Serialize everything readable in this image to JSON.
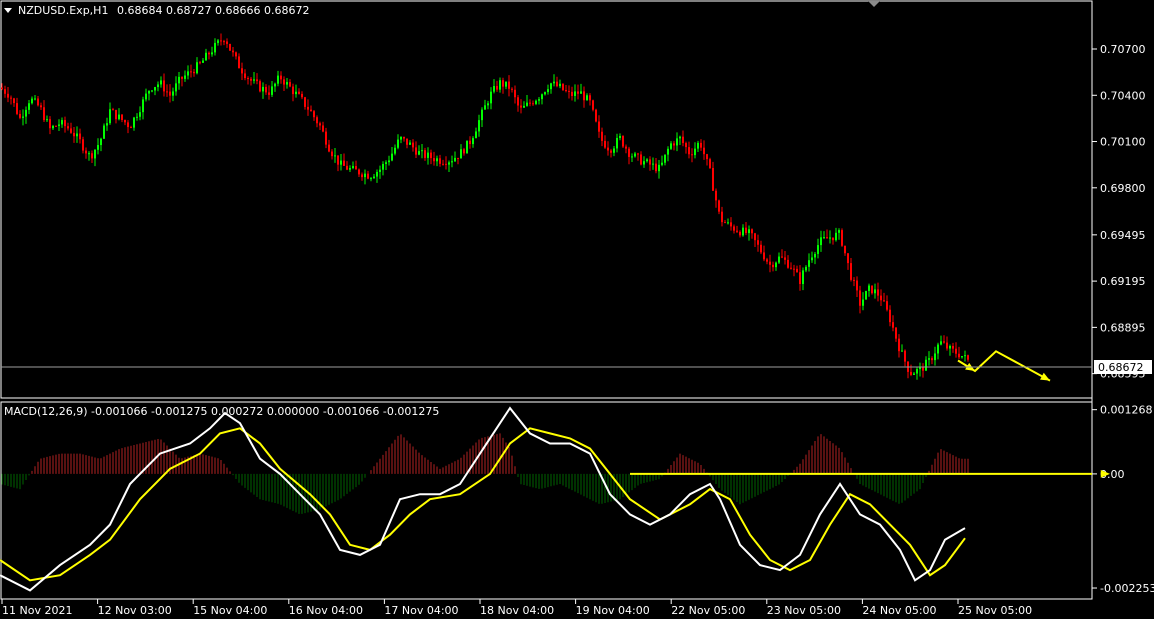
{
  "chart_data": [
    {
      "type": "candlestick",
      "symbol_label": "NZDUSD.Exp,H1",
      "ohlc_label": "0.68684 0.68727 0.68666 0.68672",
      "current_price": "0.68672",
      "y_ticks": [
        "0.70700",
        "0.70400",
        "0.70100",
        "0.69800",
        "0.69495",
        "0.69195",
        "0.68895",
        "0.68595"
      ],
      "ylim": [
        0.6845,
        0.7094
      ],
      "x_ticks": [
        "11 Nov 2021",
        "12 Nov 03:00",
        "15 Nov 04:00",
        "16 Nov 04:00",
        "17 Nov 04:00",
        "18 Nov 04:00",
        "19 Nov 04:00",
        "22 Nov 05:00",
        "23 Nov 05:00",
        "24 Nov 05:00",
        "25 Nov 05:00"
      ],
      "close_path": [
        [
          0,
          0.7045
        ],
        [
          10,
          0.704
        ],
        [
          20,
          0.7025
        ],
        [
          30,
          0.7038
        ],
        [
          40,
          0.7032
        ],
        [
          50,
          0.7018
        ],
        [
          60,
          0.7022
        ],
        [
          70,
          0.7018
        ],
        [
          80,
          0.701
        ],
        [
          90,
          0.7
        ],
        [
          100,
          0.701
        ],
        [
          110,
          0.703
        ],
        [
          120,
          0.7025
        ],
        [
          130,
          0.702
        ],
        [
          140,
          0.7032
        ],
        [
          150,
          0.7045
        ],
        [
          160,
          0.7048
        ],
        [
          170,
          0.704
        ],
        [
          180,
          0.705
        ],
        [
          190,
          0.7055
        ],
        [
          200,
          0.706
        ],
        [
          210,
          0.7068
        ],
        [
          220,
          0.7075
        ],
        [
          225,
          0.7078
        ],
        [
          230,
          0.707
        ],
        [
          240,
          0.7058
        ],
        [
          250,
          0.705
        ],
        [
          260,
          0.7045
        ],
        [
          270,
          0.7042
        ],
        [
          280,
          0.7052
        ],
        [
          290,
          0.7045
        ],
        [
          300,
          0.7038
        ],
        [
          310,
          0.703
        ],
        [
          320,
          0.702
        ],
        [
          330,
          0.7005
        ],
        [
          340,
          0.6995
        ],
        [
          350,
          0.6992
        ],
        [
          360,
          0.699
        ],
        [
          370,
          0.6988
        ],
        [
          380,
          0.6992
        ],
        [
          390,
          0.7
        ],
        [
          400,
          0.7012
        ],
        [
          410,
          0.7008
        ],
        [
          420,
          0.7002
        ],
        [
          430,
          0.7
        ],
        [
          440,
          0.6998
        ],
        [
          450,
          0.6998
        ],
        [
          460,
          0.7002
        ],
        [
          470,
          0.701
        ],
        [
          480,
          0.7025
        ],
        [
          490,
          0.704
        ],
        [
          500,
          0.7048
        ],
        [
          510,
          0.7045
        ],
        [
          520,
          0.703
        ],
        [
          530,
          0.7035
        ],
        [
          540,
          0.704
        ],
        [
          550,
          0.7048
        ],
        [
          560,
          0.7045
        ],
        [
          570,
          0.704
        ],
        [
          580,
          0.7042
        ],
        [
          590,
          0.7035
        ],
        [
          600,
          0.7012
        ],
        [
          610,
          0.7005
        ],
        [
          620,
          0.7012
        ],
        [
          630,
          0.7002
        ],
        [
          640,
          0.6998
        ],
        [
          650,
          0.6995
        ],
        [
          660,
          0.6992
        ],
        [
          670,
          0.7008
        ],
        [
          680,
          0.7012
        ],
        [
          690,
          0.7002
        ],
        [
          700,
          0.701
        ],
        [
          710,
          0.699
        ],
        [
          720,
          0.696
        ],
        [
          730,
          0.6955
        ],
        [
          740,
          0.6952
        ],
        [
          750,
          0.695
        ],
        [
          760,
          0.694
        ],
        [
          770,
          0.693
        ],
        [
          780,
          0.6935
        ],
        [
          790,
          0.693
        ],
        [
          800,
          0.692
        ],
        [
          810,
          0.6935
        ],
        [
          820,
          0.6945
        ],
        [
          830,
          0.6948
        ],
        [
          840,
          0.695
        ],
        [
          850,
          0.6925
        ],
        [
          860,
          0.6905
        ],
        [
          870,
          0.6915
        ],
        [
          880,
          0.691
        ],
        [
          890,
          0.6895
        ],
        [
          900,
          0.6875
        ],
        [
          910,
          0.686
        ],
        [
          920,
          0.6862
        ],
        [
          930,
          0.6868
        ],
        [
          940,
          0.688
        ],
        [
          950,
          0.6875
        ],
        [
          960,
          0.6872
        ],
        [
          970,
          0.6867
        ]
      ],
      "annotation_arrow": [
        [
          958,
          0.6868
        ],
        [
          975,
          0.68612
        ],
        [
          996,
          0.6874
        ],
        [
          1050,
          0.6855
        ]
      ]
    },
    {
      "type": "macd",
      "label": "MACD(12,26,9) -0.001066 -0.001275 0.000272 0.000000 -0.001066 -0.001275",
      "y_ticks": [
        "0.001268",
        "0.00",
        "-0.002253"
      ],
      "ylim": [
        -0.00245,
        0.00138
      ],
      "macd_line": [
        [
          0,
          -0.002
        ],
        [
          30,
          -0.0023
        ],
        [
          60,
          -0.0018
        ],
        [
          90,
          -0.0014
        ],
        [
          110,
          -0.001
        ],
        [
          130,
          -0.0002
        ],
        [
          160,
          0.0004
        ],
        [
          190,
          0.0006
        ],
        [
          210,
          0.0009
        ],
        [
          225,
          0.0012
        ],
        [
          240,
          0.001
        ],
        [
          260,
          0.0003
        ],
        [
          280,
          0.0
        ],
        [
          300,
          -0.0004
        ],
        [
          320,
          -0.0008
        ],
        [
          340,
          -0.0015
        ],
        [
          360,
          -0.0016
        ],
        [
          380,
          -0.0014
        ],
        [
          400,
          -0.0005
        ],
        [
          420,
          -0.0004
        ],
        [
          440,
          -0.0004
        ],
        [
          460,
          -0.0002
        ],
        [
          480,
          0.0004
        ],
        [
          500,
          0.001
        ],
        [
          510,
          0.0013
        ],
        [
          530,
          0.0008
        ],
        [
          550,
          0.0006
        ],
        [
          570,
          0.0006
        ],
        [
          590,
          0.0004
        ],
        [
          610,
          -0.0004
        ],
        [
          630,
          -0.0008
        ],
        [
          650,
          -0.001
        ],
        [
          670,
          -0.0008
        ],
        [
          690,
          -0.0004
        ],
        [
          710,
          -0.0002
        ],
        [
          720,
          -0.0005
        ],
        [
          740,
          -0.0014
        ],
        [
          760,
          -0.0018
        ],
        [
          780,
          -0.0019
        ],
        [
          800,
          -0.0016
        ],
        [
          820,
          -0.0008
        ],
        [
          840,
          -0.0002
        ],
        [
          860,
          -0.0008
        ],
        [
          880,
          -0.001
        ],
        [
          900,
          -0.0015
        ],
        [
          915,
          -0.0021
        ],
        [
          930,
          -0.0019
        ],
        [
          945,
          -0.0013
        ],
        [
          965,
          -0.00107
        ]
      ],
      "signal_line": [
        [
          0,
          -0.0017
        ],
        [
          30,
          -0.0021
        ],
        [
          60,
          -0.002
        ],
        [
          90,
          -0.0016
        ],
        [
          110,
          -0.0013
        ],
        [
          140,
          -0.0005
        ],
        [
          170,
          0.0001
        ],
        [
          200,
          0.0004
        ],
        [
          220,
          0.0008
        ],
        [
          240,
          0.0009
        ],
        [
          260,
          0.0006
        ],
        [
          280,
          0.0001
        ],
        [
          310,
          -0.0004
        ],
        [
          330,
          -0.0008
        ],
        [
          350,
          -0.0014
        ],
        [
          370,
          -0.0015
        ],
        [
          390,
          -0.0012
        ],
        [
          410,
          -0.0008
        ],
        [
          430,
          -0.0005
        ],
        [
          460,
          -0.0004
        ],
        [
          490,
          0.0
        ],
        [
          510,
          0.0006
        ],
        [
          530,
          0.0009
        ],
        [
          550,
          0.0008
        ],
        [
          570,
          0.0007
        ],
        [
          590,
          0.0005
        ],
        [
          610,
          0.0
        ],
        [
          630,
          -0.0005
        ],
        [
          660,
          -0.0009
        ],
        [
          690,
          -0.0006
        ],
        [
          710,
          -0.0003
        ],
        [
          730,
          -0.0005
        ],
        [
          750,
          -0.0012
        ],
        [
          770,
          -0.0017
        ],
        [
          790,
          -0.0019
        ],
        [
          810,
          -0.0017
        ],
        [
          830,
          -0.001
        ],
        [
          850,
          -0.0004
        ],
        [
          870,
          -0.0006
        ],
        [
          890,
          -0.001
        ],
        [
          910,
          -0.0014
        ],
        [
          930,
          -0.002
        ],
        [
          945,
          -0.0018
        ],
        [
          965,
          -0.00127
        ]
      ],
      "histogram": [
        [
          0,
          -0.0002
        ],
        [
          20,
          -0.0003
        ],
        [
          40,
          0.0003
        ],
        [
          60,
          0.0004
        ],
        [
          80,
          0.0004
        ],
        [
          100,
          0.0003
        ],
        [
          120,
          0.0005
        ],
        [
          140,
          0.0006
        ],
        [
          160,
          0.0007
        ],
        [
          180,
          0.0003
        ],
        [
          200,
          0.0004
        ],
        [
          220,
          0.0003
        ],
        [
          240,
          -0.0002
        ],
        [
          260,
          -0.0005
        ],
        [
          280,
          -0.0006
        ],
        [
          300,
          -0.0008
        ],
        [
          320,
          -0.0007
        ],
        [
          340,
          -0.0005
        ],
        [
          360,
          -0.0002
        ],
        [
          380,
          0.0003
        ],
        [
          400,
          0.0008
        ],
        [
          420,
          0.0004
        ],
        [
          440,
          0.0001
        ],
        [
          460,
          0.0003
        ],
        [
          480,
          0.0007
        ],
        [
          500,
          0.0008
        ],
        [
          510,
          0.0005
        ],
        [
          520,
          -0.0002
        ],
        [
          540,
          -0.0003
        ],
        [
          560,
          -0.0002
        ],
        [
          580,
          -0.0004
        ],
        [
          600,
          -0.0006
        ],
        [
          620,
          -0.0005
        ],
        [
          640,
          -0.0002
        ],
        [
          660,
          -0.0001
        ],
        [
          680,
          0.0004
        ],
        [
          700,
          0.0002
        ],
        [
          720,
          -0.0003
        ],
        [
          740,
          -0.0006
        ],
        [
          760,
          -0.0004
        ],
        [
          780,
          -0.0002
        ],
        [
          800,
          0.0002
        ],
        [
          820,
          0.0008
        ],
        [
          840,
          0.0005
        ],
        [
          860,
          -0.0002
        ],
        [
          880,
          -0.0004
        ],
        [
          900,
          -0.0006
        ],
        [
          920,
          -0.0003
        ],
        [
          940,
          0.0005
        ],
        [
          960,
          0.0003
        ]
      ],
      "zero_line_label": "0.00"
    }
  ],
  "colors": {
    "bull": "#00ff00",
    "bear": "#ff0000",
    "background": "#000000",
    "grid": "#ffffff",
    "macd_line": "#ffffff",
    "signal_line": "#ffff00",
    "hist_pos": "#b22222",
    "hist_neg": "#006400",
    "annotation": "#ffff00"
  }
}
